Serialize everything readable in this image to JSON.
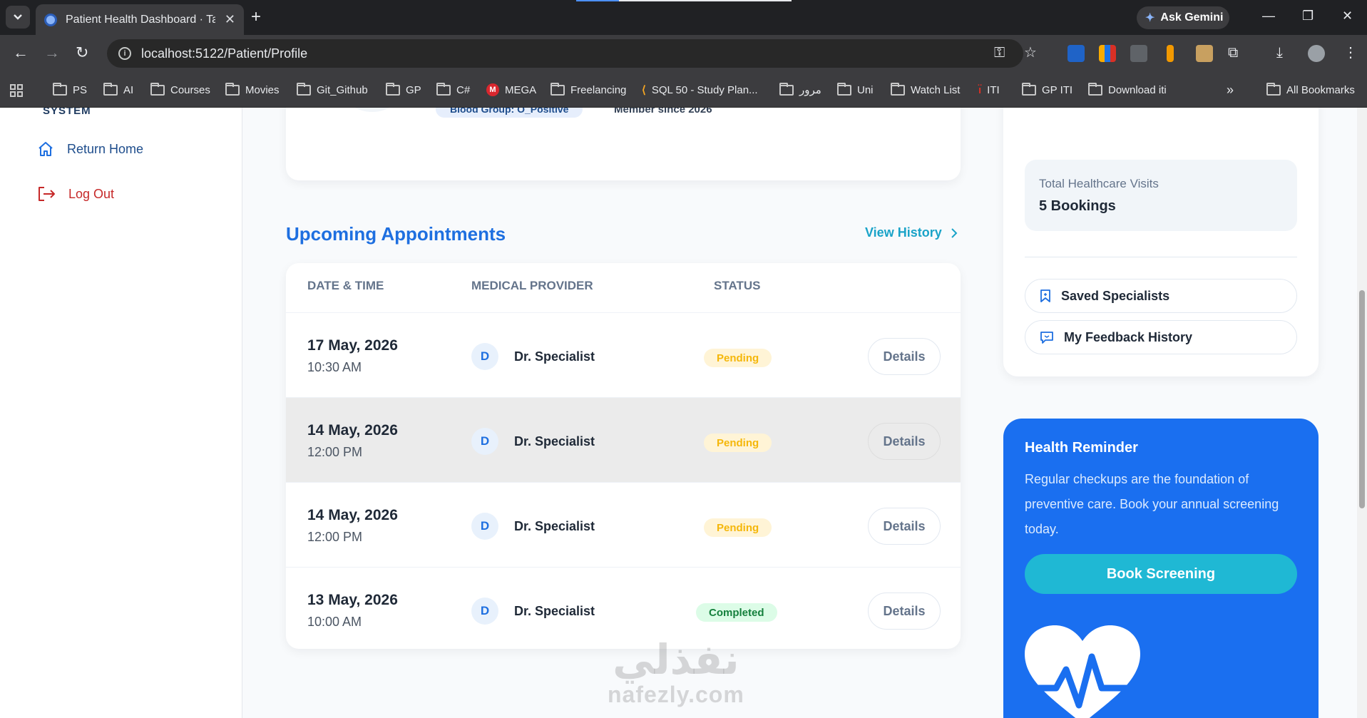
{
  "browser": {
    "tab_title": "Patient Health Dashboard · Tabi",
    "url": "localhost:5122/Patient/Profile",
    "ask_gemini": "Ask Gemini",
    "bookmarks": [
      "PS",
      "AI",
      "Courses",
      "Movies",
      "Git_Github",
      "GP",
      "C#",
      "MEGA",
      "Freelancing",
      "SQL 50 - Study Plan...",
      "مرور",
      "Uni",
      "Watch List",
      "ITI",
      "GP ITI",
      "Download iti"
    ],
    "all_bookmarks": "All Bookmarks"
  },
  "sidebar": {
    "brand_partial": "SYSTEM",
    "return_home": "Return Home",
    "log_out": "Log Out"
  },
  "profile": {
    "blood_group": "Blood Group: O_Positive",
    "member_since": "Member since 2026"
  },
  "appointments": {
    "title": "Upcoming Appointments",
    "view_history": "View History",
    "headers": {
      "date_time": "DATE & TIME",
      "provider": "MEDICAL PROVIDER",
      "status": "STATUS"
    },
    "rows": [
      {
        "date": "17 May, 2026",
        "time": "10:30 AM",
        "initial": "D",
        "doctor": "Dr. Specialist",
        "status": "Pending",
        "details": "Details"
      },
      {
        "date": "14 May, 2026",
        "time": "12:00 PM",
        "initial": "D",
        "doctor": "Dr. Specialist",
        "status": "Pending",
        "details": "Details"
      },
      {
        "date": "14 May, 2026",
        "time": "12:00 PM",
        "initial": "D",
        "doctor": "Dr. Specialist",
        "status": "Pending",
        "details": "Details"
      },
      {
        "date": "13 May, 2026",
        "time": "10:00 AM",
        "initial": "D",
        "doctor": "Dr. Specialist",
        "status": "Completed",
        "details": "Details"
      }
    ]
  },
  "stats": {
    "visits_label": "Total Healthcare Visits",
    "visits_value": "5 Bookings",
    "saved_specialists": "Saved Specialists",
    "feedback_history": "My Feedback History"
  },
  "reminder": {
    "title": "Health Reminder",
    "text": "Regular checkups are the foundation of preventive care. Book your annual screening today.",
    "cta": "Book Screening"
  },
  "watermark": {
    "arabic": "نفذلي",
    "latin": "nafezly.com"
  },
  "colors": {
    "primary": "#1e6fe0",
    "accent": "#1aa3c8",
    "reminder_bg": "#1a6ff0",
    "pending": "#f5b70a",
    "completed": "#15803d",
    "logout": "#c62828"
  }
}
